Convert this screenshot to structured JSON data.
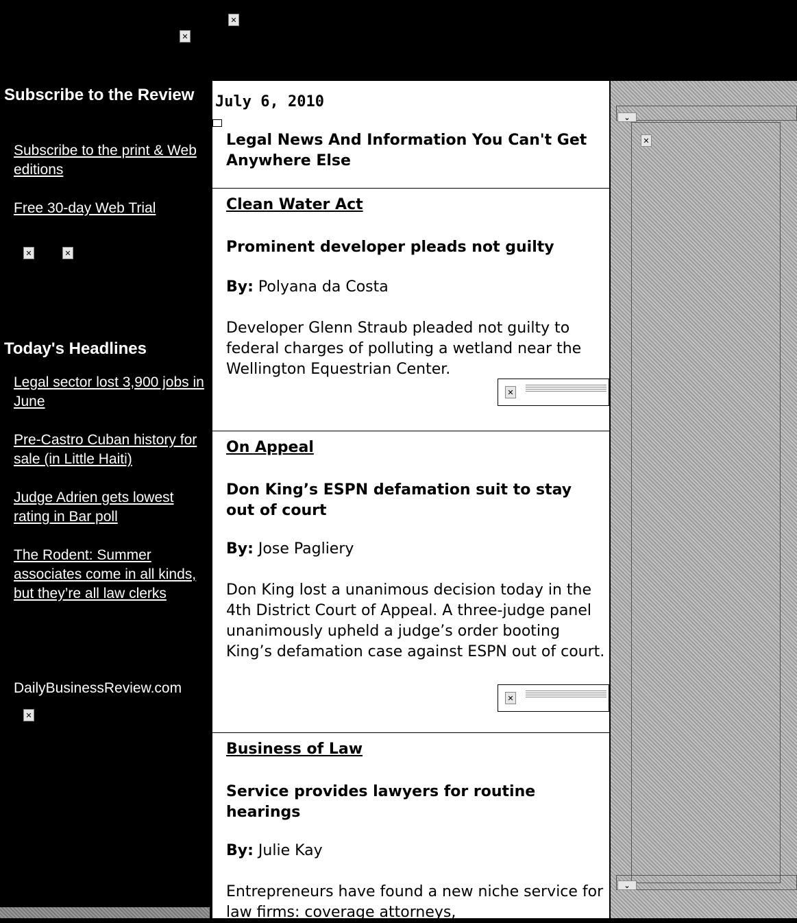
{
  "header": {
    "images": [
      "broken-image",
      "broken-image"
    ]
  },
  "sidebar": {
    "subscribe_heading": "Subscribe to the Review",
    "subscribe_links": [
      "Subscribe to the print & Web editions",
      "Free 30-day Web Trial"
    ],
    "headlines_heading": "Today's Headlines",
    "headline_links": [
      "Legal sector lost 3,900 jobs in June",
      "Pre-Castro Cuban history for sale (in Little Haiti)",
      "Judge Adrien gets lowest rating in Bar poll",
      "The Rodent: Summer associates come in all kinds, but they’re all law clerks"
    ],
    "site_name": "DailyBusinessReview.com"
  },
  "main": {
    "date": "July 6, 2010",
    "tagline": "Legal News And Information You Can't Get Anywhere Else",
    "byline_label": "By:",
    "articles": [
      {
        "section": "Clean Water Act",
        "headline": "Prominent developer pleads not guilty",
        "author": "Polyana da Costa",
        "summary": "Developer Glenn Straub pleaded not guilty to federal charges of polluting a wetland near the Wellington Equestrian Center."
      },
      {
        "section": "On Appeal",
        "headline": "Don King’s ESPN defamation suit to stay out of court",
        "author": "Jose Pagliery",
        "summary": "Don King lost a unanimous decision today in the 4th District Court of Appeal. A three-judge panel unanimously upheld a judge’s order booting King’s defamation case against ESPN out of court."
      },
      {
        "section": "Business of Law",
        "headline": "Service provides lawyers for routine hearings",
        "author": "Julie Kay",
        "summary": "Entrepreneurs have found a new niche service for law firms: coverage attorneys,"
      }
    ]
  },
  "icons": {
    "broken_image": "broken-image-icon"
  }
}
